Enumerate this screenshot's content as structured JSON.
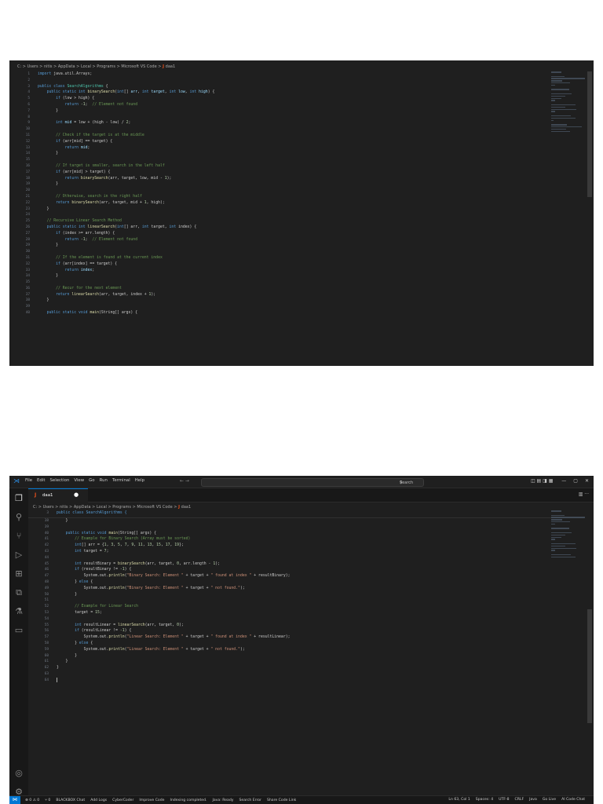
{
  "top": {
    "breadcrumb": [
      "C:",
      "Users",
      "nitis",
      "AppData",
      "Local",
      "Programs",
      "Microsoft VS Code",
      "daa1"
    ],
    "breadcrumb_sep": ">",
    "file_icon": "J",
    "line_numbers": [
      "1",
      "2",
      "3",
      "4",
      "5",
      "6",
      "7",
      "8",
      "9",
      "10",
      "11",
      "12",
      "13",
      "14",
      "15",
      "16",
      "17",
      "18",
      "19",
      "20",
      "21",
      "22",
      "23",
      "24",
      "25",
      "26",
      "27",
      "28",
      "29",
      "30",
      "31",
      "32",
      "33",
      "34",
      "35",
      "36",
      "37",
      "38",
      "39",
      "40"
    ],
    "lines": [
      [
        [
          "kw",
          "import "
        ],
        [
          "",
          "java.util.Arrays;"
        ]
      ],
      [],
      [
        [
          "kw",
          "public class "
        ],
        [
          "cls",
          "SearchAlgorithms"
        ],
        [
          "",
          " {"
        ]
      ],
      [
        [
          "",
          "    "
        ],
        [
          "kw",
          "public static int "
        ],
        [
          "fn",
          "binarySearch"
        ],
        [
          "",
          "("
        ],
        [
          "kw",
          "int"
        ],
        [
          "",
          "[] "
        ],
        [
          "var",
          "arr"
        ],
        [
          ", "
        ],
        [
          "kw",
          "int "
        ],
        [
          "var",
          "target"
        ],
        [
          "",
          ", "
        ],
        [
          "kw",
          "int "
        ],
        [
          "var",
          "low"
        ],
        [
          "",
          ", "
        ],
        [
          "kw",
          "int "
        ],
        [
          "var",
          "high"
        ],
        [
          "",
          ") {"
        ]
      ],
      [
        [
          "",
          "        "
        ],
        [
          "kw",
          "if "
        ],
        [
          "",
          "(low > high) {"
        ]
      ],
      [
        [
          "",
          "            "
        ],
        [
          "kw",
          "return "
        ],
        [
          "num",
          "-1"
        ],
        [
          "",
          ";  "
        ],
        [
          "cm",
          "// Element not found"
        ]
      ],
      [
        [
          "",
          "        }"
        ]
      ],
      [],
      [
        [
          "",
          "        "
        ],
        [
          "kw",
          "int "
        ],
        [
          "var",
          "mid"
        ],
        [
          "",
          " = low + (high - low) / "
        ],
        [
          "num",
          "2"
        ],
        [
          "",
          ";"
        ]
      ],
      [],
      [
        [
          "",
          "        "
        ],
        [
          "cm",
          "// Check if the target is at the middle"
        ]
      ],
      [
        [
          "",
          "        "
        ],
        [
          "kw",
          "if "
        ],
        [
          "",
          "(arr[mid] == target) {"
        ]
      ],
      [
        [
          "",
          "            "
        ],
        [
          "kw",
          "return "
        ],
        [
          "var",
          "mid"
        ],
        [
          "",
          ";"
        ]
      ],
      [
        [
          "",
          "        }"
        ]
      ],
      [],
      [
        [
          "",
          "        "
        ],
        [
          "cm",
          "// If target is smaller, search in the left half"
        ]
      ],
      [
        [
          "",
          "        "
        ],
        [
          "kw",
          "if "
        ],
        [
          "",
          "(arr[mid] > target) {"
        ]
      ],
      [
        [
          "",
          "            "
        ],
        [
          "kw",
          "return "
        ],
        [
          "fn",
          "binarySearch"
        ],
        [
          "",
          "(arr, target, low, mid - "
        ],
        [
          "num",
          "1"
        ],
        [
          "",
          ");"
        ]
      ],
      [
        [
          "",
          "        }"
        ]
      ],
      [],
      [
        [
          "",
          "        "
        ],
        [
          "cm",
          "// Otherwise, search in the right half"
        ]
      ],
      [
        [
          "",
          "        "
        ],
        [
          "kw",
          "return "
        ],
        [
          "fn",
          "binarySearch"
        ],
        [
          "",
          "(arr, target, mid + "
        ],
        [
          "num",
          "1"
        ],
        [
          "",
          ", high);"
        ]
      ],
      [
        [
          "",
          "    }"
        ]
      ],
      [],
      [
        [
          "",
          "    "
        ],
        [
          "cm",
          "// Recursive Linear Search Method"
        ]
      ],
      [
        [
          "",
          "    "
        ],
        [
          "kw",
          "public static int "
        ],
        [
          "fn",
          "linearSearch"
        ],
        [
          "",
          "("
        ],
        [
          "kw",
          "int"
        ],
        [
          "",
          "[] arr, "
        ],
        [
          "kw",
          "int "
        ],
        [
          "",
          "target, "
        ],
        [
          "kw",
          "int "
        ],
        [
          "",
          "index) {"
        ]
      ],
      [
        [
          "",
          "        "
        ],
        [
          "kw",
          "if "
        ],
        [
          "",
          "(index >= arr.length) {"
        ]
      ],
      [
        [
          "",
          "            "
        ],
        [
          "kw",
          "return "
        ],
        [
          "num",
          "-1"
        ],
        [
          "",
          ";  "
        ],
        [
          "cm",
          "// Element not found"
        ]
      ],
      [
        [
          "",
          "        }"
        ]
      ],
      [],
      [
        [
          "",
          "        "
        ],
        [
          "cm",
          "// If the element is found at the current index"
        ]
      ],
      [
        [
          "",
          "        "
        ],
        [
          "kw",
          "if "
        ],
        [
          "",
          "(arr[index] == target) {"
        ]
      ],
      [
        [
          "",
          "            "
        ],
        [
          "kw",
          "return "
        ],
        [
          "var",
          "index"
        ],
        [
          "",
          ";"
        ]
      ],
      [
        [
          "",
          "        }"
        ]
      ],
      [],
      [
        [
          "",
          "        "
        ],
        [
          "cm",
          "// Recur for the next element"
        ]
      ],
      [
        [
          "",
          "        "
        ],
        [
          "kw",
          "return "
        ],
        [
          "fn",
          "linearSearch"
        ],
        [
          "",
          "(arr, target, index + "
        ],
        [
          "num",
          "1"
        ],
        [
          "",
          ");"
        ]
      ],
      [
        [
          "",
          "    }"
        ]
      ],
      [],
      [
        [
          "",
          "    "
        ],
        [
          "kw",
          "public static void "
        ],
        [
          "fn",
          "main"
        ],
        [
          "",
          "(String[] args) {"
        ]
      ]
    ]
  },
  "bottom": {
    "menu": [
      "File",
      "Edit",
      "Selection",
      "View",
      "Go",
      "Run",
      "Terminal",
      "Help"
    ],
    "nav_arrows": "← →",
    "search_placeholder": "Search",
    "window_buttons": [
      "—",
      "▢",
      "✕"
    ],
    "tab": {
      "icon": "J",
      "name": "daa1",
      "dirty": "●"
    },
    "tab_actions": "▥ ···",
    "breadcrumb": [
      "C:",
      "Users",
      "nitis",
      "AppData",
      "Local",
      "Programs",
      "Microsoft VS Code",
      "daa1"
    ],
    "sticky": {
      "line_number": "3",
      "text": "public class SearchAlgorithms {"
    },
    "line_numbers": [
      "38",
      "39",
      "40",
      "41",
      "42",
      "43",
      "44",
      "45",
      "46",
      "47",
      "48",
      "49",
      "50",
      "51",
      "52",
      "53",
      "54",
      "55",
      "56",
      "57",
      "58",
      "59",
      "60",
      "61",
      "62",
      "63",
      "64"
    ],
    "lines": [
      [
        [
          "",
          "    }"
        ]
      ],
      [],
      [
        [
          "",
          "    "
        ],
        [
          "kw",
          "public static void "
        ],
        [
          "fn",
          "main"
        ],
        [
          "",
          "(String[] args) {"
        ]
      ],
      [
        [
          "",
          "        "
        ],
        [
          "cm",
          "// Example for Binary Search (Array must be sorted)"
        ]
      ],
      [
        [
          "",
          "        "
        ],
        [
          "kw",
          "int"
        ],
        [
          "",
          "[] arr = {"
        ],
        [
          "num",
          "1"
        ],
        [
          "",
          ", "
        ],
        [
          "num",
          "3"
        ],
        [
          "",
          ", "
        ],
        [
          "num",
          "5"
        ],
        [
          "",
          ", "
        ],
        [
          "num",
          "7"
        ],
        [
          "",
          ", "
        ],
        [
          "num",
          "9"
        ],
        [
          "",
          ", "
        ],
        [
          "num",
          "11"
        ],
        [
          "",
          ", "
        ],
        [
          "num",
          "13"
        ],
        [
          "",
          ", "
        ],
        [
          "num",
          "15"
        ],
        [
          "",
          ", "
        ],
        [
          "num",
          "17"
        ],
        [
          "",
          ", "
        ],
        [
          "num",
          "19"
        ],
        [
          "",
          "};"
        ]
      ],
      [
        [
          "",
          "        "
        ],
        [
          "kw",
          "int "
        ],
        [
          "",
          "target = "
        ],
        [
          "num",
          "7"
        ],
        [
          "",
          ";"
        ]
      ],
      [],
      [
        [
          "",
          "        "
        ],
        [
          "kw",
          "int "
        ],
        [
          "",
          "resultBinary = "
        ],
        [
          "fn",
          "binarySearch"
        ],
        [
          "",
          "(arr, target, "
        ],
        [
          "num",
          "0"
        ],
        [
          "",
          ", arr.length - "
        ],
        [
          "num",
          "1"
        ],
        [
          "",
          ");"
        ]
      ],
      [
        [
          "",
          "        "
        ],
        [
          "kw",
          "if "
        ],
        [
          "",
          "(resultBinary != "
        ],
        [
          "num",
          "-1"
        ],
        [
          "",
          ") {"
        ]
      ],
      [
        [
          "",
          "            System.out."
        ],
        [
          "fn",
          "println"
        ],
        [
          "",
          "("
        ],
        [
          "str",
          "\"Binary Search: Element \""
        ],
        [
          "",
          " + target + "
        ],
        [
          "str",
          "\" found at index \""
        ],
        [
          "",
          " + resultBinary);"
        ]
      ],
      [
        [
          "",
          "        } "
        ],
        [
          "kw",
          "else "
        ],
        [
          "",
          "{"
        ]
      ],
      [
        [
          "",
          "            System.out."
        ],
        [
          "fn",
          "println"
        ],
        [
          "",
          "("
        ],
        [
          "str",
          "\"Binary Search: Element \""
        ],
        [
          "",
          " + target + "
        ],
        [
          "str",
          "\" not found.\""
        ],
        [
          "",
          ");"
        ]
      ],
      [
        [
          "",
          "        }"
        ]
      ],
      [],
      [
        [
          "",
          "        "
        ],
        [
          "cm",
          "// Example for Linear Search"
        ]
      ],
      [
        [
          "",
          "        "
        ],
        [
          "",
          "target = "
        ],
        [
          "num",
          "15"
        ],
        [
          "",
          ";"
        ]
      ],
      [],
      [
        [
          "",
          "        "
        ],
        [
          "kw",
          "int "
        ],
        [
          "",
          "resultLinear = "
        ],
        [
          "fn",
          "linearSearch"
        ],
        [
          "",
          "(arr, target, "
        ],
        [
          "num",
          "0"
        ],
        [
          "",
          ");"
        ]
      ],
      [
        [
          "",
          "        "
        ],
        [
          "kw",
          "if "
        ],
        [
          "",
          "(resultLinear != "
        ],
        [
          "num",
          "-1"
        ],
        [
          "",
          ") {"
        ]
      ],
      [
        [
          "",
          "            System.out."
        ],
        [
          "fn",
          "println"
        ],
        [
          "",
          "("
        ],
        [
          "str",
          "\"Linear Search: Element \""
        ],
        [
          "",
          " + target + "
        ],
        [
          "str",
          "\" found at index \""
        ],
        [
          "",
          " + resultLinear);"
        ]
      ],
      [
        [
          "",
          "        } "
        ],
        [
          "kw",
          "else "
        ],
        [
          "",
          "{"
        ]
      ],
      [
        [
          "",
          "            System.out."
        ],
        [
          "fn",
          "println"
        ],
        [
          "",
          "("
        ],
        [
          "str",
          "\"Linear Search: Element \""
        ],
        [
          "",
          " + target + "
        ],
        [
          "str",
          "\" not found.\""
        ],
        [
          "",
          ");"
        ]
      ],
      [
        [
          "",
          "        }"
        ]
      ],
      [
        [
          "",
          "    }"
        ]
      ],
      [
        [
          "",
          "}"
        ]
      ],
      [],
      []
    ],
    "activity_icons": [
      {
        "name": "explorer-icon",
        "glyph": "❐"
      },
      {
        "name": "search-icon",
        "glyph": "⚲"
      },
      {
        "name": "source-control-icon",
        "glyph": "⑂"
      },
      {
        "name": "run-debug-icon",
        "glyph": "▷"
      },
      {
        "name": "extensions-icon",
        "glyph": "⊞"
      },
      {
        "name": "remote-explorer-icon",
        "glyph": "⧉"
      },
      {
        "name": "testing-icon",
        "glyph": "⚗"
      },
      {
        "name": "chat-icon",
        "glyph": "▭"
      }
    ],
    "account_icon": "◎",
    "settings_icon": "⚙",
    "status_left": [
      "⊗ 0 ⚠ 0",
      "⑂ 0",
      "BLACKBOX Chat",
      "Add Logs",
      "CyberCoder",
      "Improve Code",
      "Indexing completed.",
      "Java: Ready",
      "Search Error",
      "Share Code Link"
    ],
    "status_right": [
      "Ln 63, Col 1",
      "Spaces: 4",
      "UTF-8",
      "CRLF",
      "Java",
      "Go Live",
      "AI Code Chat"
    ],
    "accent": "#0078d4"
  }
}
